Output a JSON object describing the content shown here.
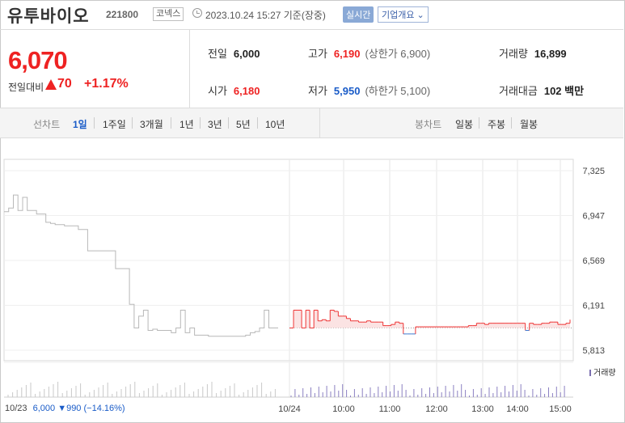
{
  "stock": {
    "name": "유투바이오",
    "code": "221800",
    "market": "코넥스",
    "datetime": "2023.10.24 15:27 기준(장중)",
    "realtime": "실시간",
    "overview": "기업개요 ⌄"
  },
  "quote": {
    "price": "6,070",
    "change_label": "전일대비",
    "change_value": "70",
    "change_pct": "+1.17%",
    "prev_label": "전일",
    "prev": "6,000",
    "open_label": "시가",
    "open": "6,180",
    "high_label": "고가",
    "high": "6,190",
    "upper_limit": "(상한가 6,900)",
    "low_label": "저가",
    "low": "5,950",
    "lower_limit": "(하한가 5,100)",
    "volume_label": "거래량",
    "volume": "16,899",
    "amount_label": "거래대금",
    "amount": "102 백만"
  },
  "periods": {
    "line_label": "선차트",
    "line_options": [
      "1일",
      "1주일",
      "3개월",
      "1년",
      "3년",
      "5년",
      "10년"
    ],
    "selected": "1일",
    "candle_label": "봉차트",
    "candle_options": [
      "일봉",
      "주봉",
      "월봉"
    ]
  },
  "chart_data": {
    "type": "line",
    "y_ticks": [
      "7,325",
      "6,947",
      "6,569",
      "6,191",
      "5,813"
    ],
    "ylim": [
      5813,
      7325
    ],
    "x_ticks": [
      "10/23",
      "10/24",
      "10:00",
      "11:00",
      "12:00",
      "13:00",
      "14:00",
      "15:00"
    ],
    "baseline": 6000,
    "prev_day": {
      "label": "10/23",
      "close_text": "6,000",
      "change_text": "▼990",
      "pct_text": "(−14.16%)",
      "values": [
        6980,
        7010,
        7120,
        6990,
        7100,
        6990,
        6990,
        6960,
        6960,
        6890,
        6880,
        6870,
        6870,
        6860,
        6860,
        6860,
        6830,
        6830,
        6650,
        6650,
        6650,
        6650,
        6650,
        6650,
        6500,
        6500,
        6500,
        6200,
        6000,
        6100,
        6150,
        5980,
        5990,
        5980,
        5980,
        5980,
        5960,
        6000,
        6150,
        5960,
        6000,
        5940,
        5940,
        5940,
        5930,
        5930,
        5930,
        5930,
        5930,
        5930,
        5930,
        5930,
        5940,
        5960,
        5970,
        6000,
        6150,
        6000,
        6000,
        6000
      ]
    },
    "today": {
      "label": "10/24",
      "values": [
        6000,
        6150,
        6150,
        6000,
        6150,
        6000,
        6150,
        6060,
        6070,
        6060,
        6150,
        6140,
        6100,
        6100,
        6080,
        6060,
        6060,
        6050,
        6050,
        6060,
        6050,
        6050,
        6050,
        6020,
        6020,
        6030,
        6050,
        6040,
        5950,
        5950,
        5950,
        6010,
        6010,
        6010,
        6010,
        6010,
        6010,
        6010,
        6010,
        6010,
        6010,
        6010,
        6010,
        6010,
        6020,
        6020,
        6040,
        6040,
        6030,
        6040,
        6040,
        6040,
        6040,
        6040,
        6040,
        6040,
        6040,
        6040,
        5980,
        6040,
        6030,
        6030,
        6040,
        6040,
        6050,
        6050,
        6030,
        6030,
        6040,
        6070
      ]
    },
    "volume_legend": "거래량"
  }
}
